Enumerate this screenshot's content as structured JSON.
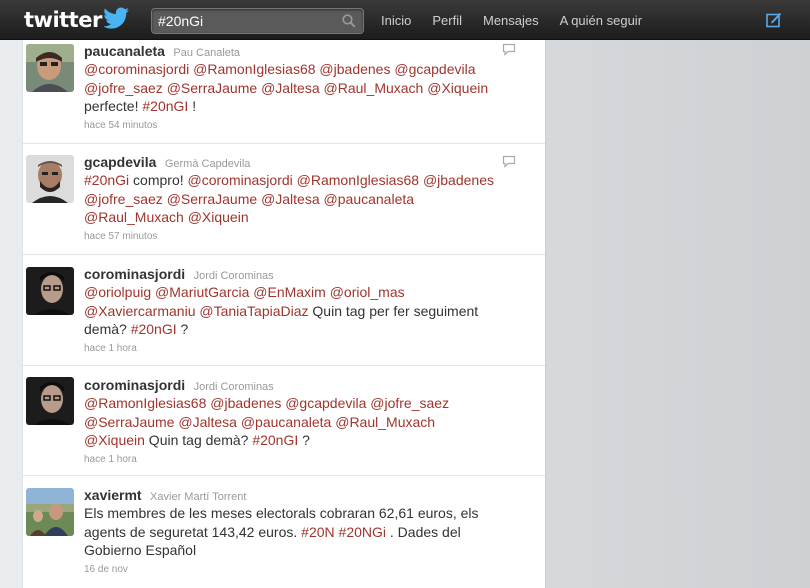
{
  "header": {
    "logo_text": "twitter",
    "search": {
      "value": "#20nGi",
      "placeholder": ""
    },
    "nav": [
      {
        "label": "Inicio"
      },
      {
        "label": "Perfil"
      },
      {
        "label": "Mensajes"
      },
      {
        "label": "A quién seguir"
      }
    ]
  },
  "colors": {
    "topbar": "#2b2b2b",
    "link": "#a0352d",
    "text": "#333333",
    "meta": "#999999",
    "background": "#d9dcdf"
  },
  "tweets": [
    {
      "screen_name": "paucanaleta",
      "full_name": "Pau Canaleta",
      "time": "hace 54 minutos",
      "lines": [
        [
          {
            "t": "@corominasjordi",
            "link": true
          },
          {
            "t": " ",
            "link": false
          },
          {
            "t": "@RamonIglesias68",
            "link": true
          },
          {
            "t": " ",
            "link": false
          },
          {
            "t": "@jbadenes",
            "link": true
          },
          {
            "t": " ",
            "link": false
          },
          {
            "t": "@gcapdevila",
            "link": true
          }
        ],
        [
          {
            "t": "@jofre_saez",
            "link": true
          },
          {
            "t": " ",
            "link": false
          },
          {
            "t": "@SerraJaume",
            "link": true
          },
          {
            "t": " ",
            "link": false
          },
          {
            "t": "@Jaltesa",
            "link": true
          },
          {
            "t": " ",
            "link": false
          },
          {
            "t": "@Raul_Muxach",
            "link": true
          },
          {
            "t": " ",
            "link": false
          },
          {
            "t": "@Xiquein",
            "link": true
          }
        ],
        [
          {
            "t": "perfecte! ",
            "link": false
          },
          {
            "t": "#20nGI",
            "link": true
          },
          {
            "t": " !",
            "link": false
          }
        ]
      ]
    },
    {
      "screen_name": "gcapdevila",
      "full_name": "Germà Capdevila",
      "time": "hace 57 minutos",
      "lines": [
        [
          {
            "t": "#20nGi",
            "link": true
          },
          {
            "t": " compro! ",
            "link": false
          },
          {
            "t": "@corominasjordi",
            "link": true
          },
          {
            "t": " ",
            "link": false
          },
          {
            "t": "@RamonIglesias68",
            "link": true
          },
          {
            "t": " ",
            "link": false
          },
          {
            "t": "@jbadenes",
            "link": true
          }
        ],
        [
          {
            "t": "@jofre_saez",
            "link": true
          },
          {
            "t": " ",
            "link": false
          },
          {
            "t": "@SerraJaume",
            "link": true
          },
          {
            "t": " ",
            "link": false
          },
          {
            "t": "@Jaltesa",
            "link": true
          },
          {
            "t": " ",
            "link": false
          },
          {
            "t": "@paucanaleta",
            "link": true
          }
        ],
        [
          {
            "t": "@Raul_Muxach",
            "link": true
          },
          {
            "t": " ",
            "link": false
          },
          {
            "t": "@Xiquein",
            "link": true
          }
        ]
      ]
    },
    {
      "screen_name": "corominasjordi",
      "full_name": "Jordi Corominas",
      "time": "hace 1 hora",
      "lines": [
        [
          {
            "t": "@oriolpuig",
            "link": true
          },
          {
            "t": " ",
            "link": false
          },
          {
            "t": "@MariutGarcia",
            "link": true
          },
          {
            "t": " ",
            "link": false
          },
          {
            "t": "@EnMaxim",
            "link": true
          },
          {
            "t": " ",
            "link": false
          },
          {
            "t": "@oriol_mas",
            "link": true
          }
        ],
        [
          {
            "t": "@Xaviercarmaniu",
            "link": true
          },
          {
            "t": " ",
            "link": false
          },
          {
            "t": "@TaniaTapiaDiaz",
            "link": true
          },
          {
            "t": " Quin tag per fer seguiment",
            "link": false
          }
        ],
        [
          {
            "t": "demà? ",
            "link": false
          },
          {
            "t": "#20nGI",
            "link": true
          },
          {
            "t": " ?",
            "link": false
          }
        ]
      ]
    },
    {
      "screen_name": "corominasjordi",
      "full_name": "Jordi Corominas",
      "time": "hace 1 hora",
      "lines": [
        [
          {
            "t": "@RamonIglesias68",
            "link": true
          },
          {
            "t": " ",
            "link": false
          },
          {
            "t": "@jbadenes",
            "link": true
          },
          {
            "t": " ",
            "link": false
          },
          {
            "t": "@gcapdevila",
            "link": true
          },
          {
            "t": " ",
            "link": false
          },
          {
            "t": "@jofre_saez",
            "link": true
          }
        ],
        [
          {
            "t": "@SerraJaume",
            "link": true
          },
          {
            "t": " ",
            "link": false
          },
          {
            "t": "@Jaltesa",
            "link": true
          },
          {
            "t": " ",
            "link": false
          },
          {
            "t": "@paucanaleta",
            "link": true
          },
          {
            "t": " ",
            "link": false
          },
          {
            "t": "@Raul_Muxach",
            "link": true
          }
        ],
        [
          {
            "t": "@Xiquein",
            "link": true
          },
          {
            "t": " Quin tag demà? ",
            "link": false
          },
          {
            "t": "#20nGI",
            "link": true
          },
          {
            "t": " ?",
            "link": false
          }
        ]
      ]
    },
    {
      "screen_name": "xaviermt",
      "full_name": "Xavier Martí Torrent",
      "time": "16 de nov",
      "lines": [
        [
          {
            "t": "Els membres de les meses electorals cobraran 62,61 euros, els",
            "link": false
          }
        ],
        [
          {
            "t": "agents de seguretat 143,42 euros. ",
            "link": false
          },
          {
            "t": "#20N",
            "link": true
          },
          {
            "t": " ",
            "link": false
          },
          {
            "t": "#20NGi",
            "link": true
          },
          {
            "t": " . Dades del",
            "link": false
          }
        ],
        [
          {
            "t": "Gobierno Español",
            "link": false
          }
        ]
      ]
    }
  ]
}
